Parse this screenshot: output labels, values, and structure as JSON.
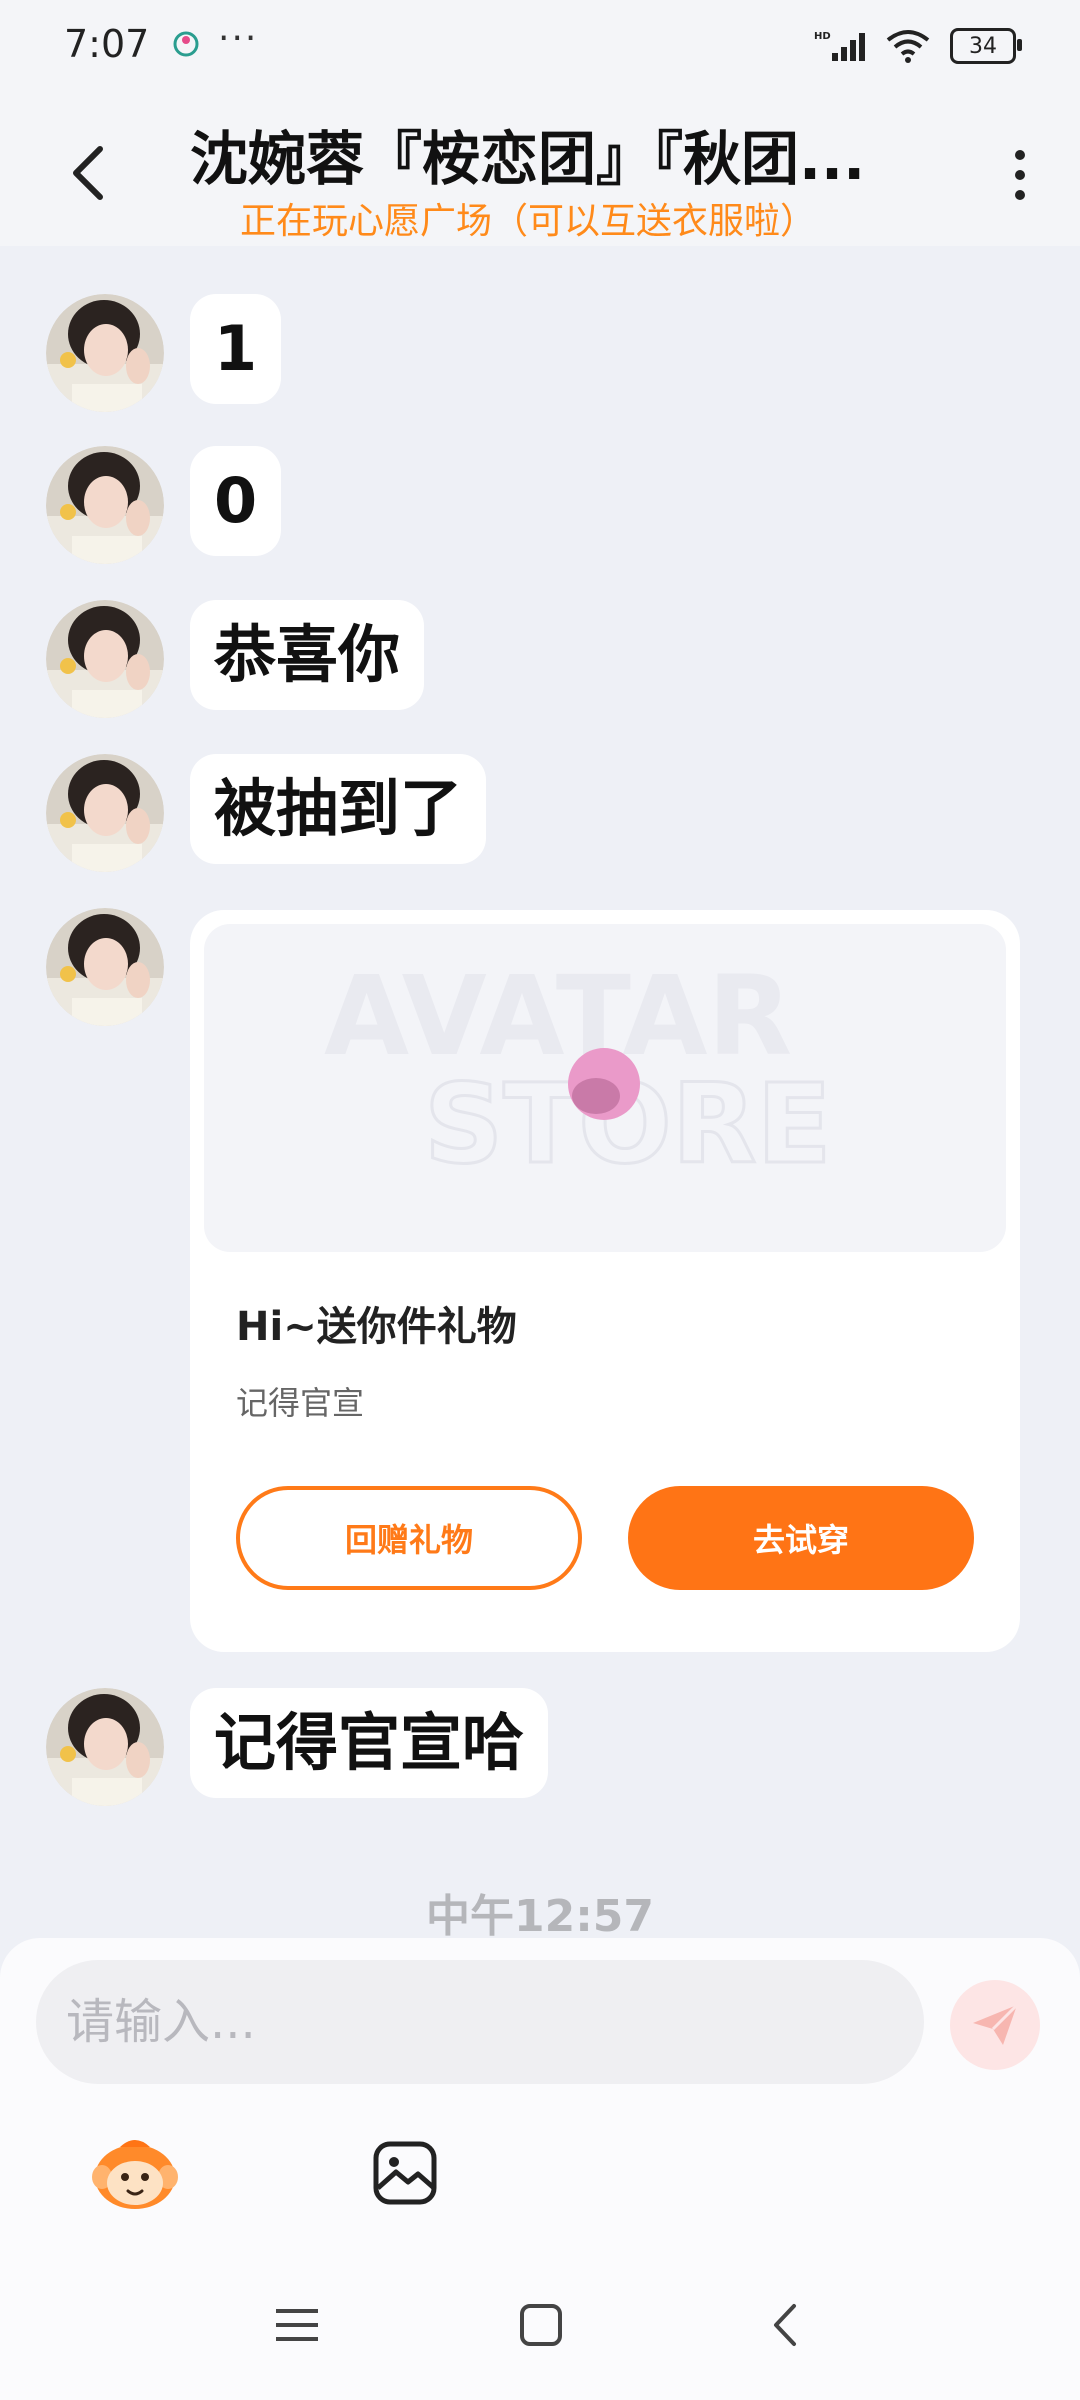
{
  "status_bar": {
    "time": "7:07",
    "dots": "···",
    "battery": "34",
    "signal_icon": "signal-icon",
    "wifi_icon": "wifi-icon"
  },
  "header": {
    "title": "沈婉蓉『桉恋团』『秋团...",
    "subtitle": "正在玩心愿广场（可以互送衣服啦）"
  },
  "messages": [
    {
      "text": "1"
    },
    {
      "text": "0"
    },
    {
      "text": "恭喜你"
    },
    {
      "text": "被抽到了"
    },
    {
      "text": "记得官宣哈"
    }
  ],
  "gift_card": {
    "image_line1": "AVATAR",
    "image_line2": "STORE",
    "title": "Hi~送你件礼物",
    "subtitle": "记得官宣",
    "return_gift_label": "回赠礼物",
    "try_on_label": "去试穿"
  },
  "timestamp": "中午12:57",
  "input": {
    "placeholder": "请输入...",
    "value": ""
  },
  "colors": {
    "accent": "#ff7415",
    "subtitle": "#ff8a1a",
    "bubble": "#ffffff",
    "background": "#eef0f6"
  }
}
